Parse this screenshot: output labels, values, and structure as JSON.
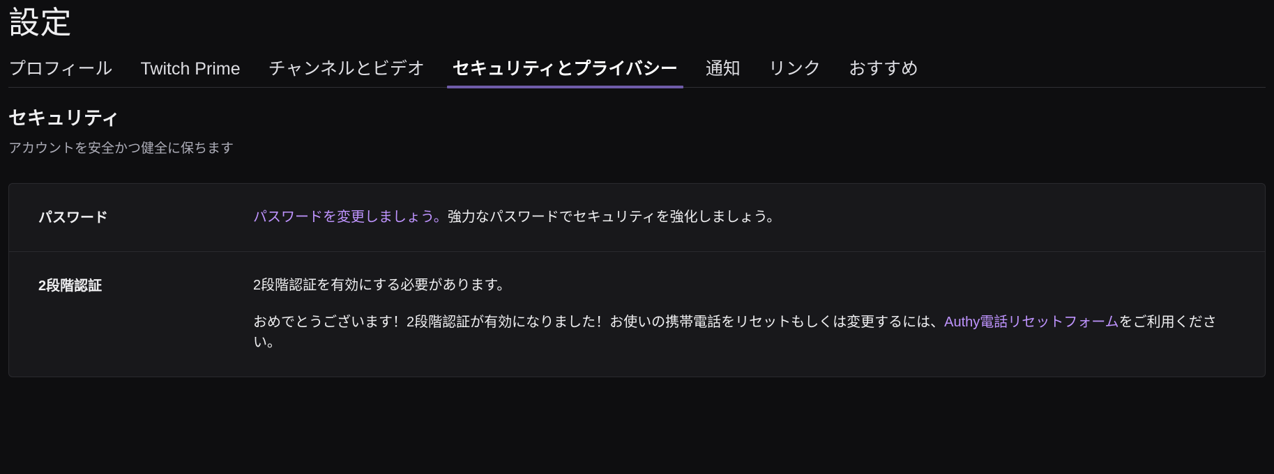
{
  "header": {
    "title": "設定"
  },
  "tabs": [
    {
      "id": "profile",
      "label": "プロフィール",
      "active": false
    },
    {
      "id": "prime",
      "label": "Twitch Prime",
      "active": false
    },
    {
      "id": "channel",
      "label": "チャンネルとビデオ",
      "active": false
    },
    {
      "id": "security",
      "label": "セキュリティとプライバシー",
      "active": true
    },
    {
      "id": "notify",
      "label": "通知",
      "active": false
    },
    {
      "id": "links",
      "label": "リンク",
      "active": false
    },
    {
      "id": "recommend",
      "label": "おすすめ",
      "active": false
    }
  ],
  "section": {
    "title": "セキュリティ",
    "subtitle": "アカウントを安全かつ健全に保ちます"
  },
  "rows": {
    "password": {
      "label": "パスワード",
      "link_text": "パスワードを変更しましょう。",
      "rest_text": "強力なパスワードでセキュリティを強化しましょう。"
    },
    "two_factor": {
      "label": "2段階認証",
      "line1": "2段階認証を有効にする必要があります。",
      "line2_pre": "おめでとうございます！2段階認証が有効になりました！お使いの携帯電話をリセットもしくは変更するには、",
      "line2_link": "Authy電話リセットフォーム",
      "line2_post": "をご利用ください。"
    }
  },
  "colors": {
    "background": "#0e0e10",
    "card": "#18181b",
    "accent": "#6e5ba8",
    "link": "#bf94ff",
    "muted": "#adadb8"
  }
}
